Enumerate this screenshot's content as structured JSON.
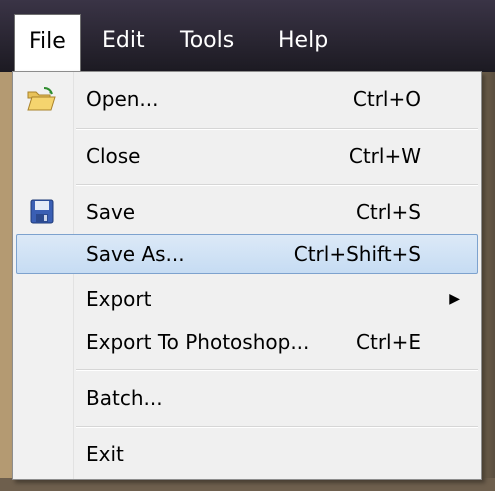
{
  "menubar": {
    "items": [
      {
        "label": "File"
      },
      {
        "label": "Edit"
      },
      {
        "label": "Tools"
      },
      {
        "label": "Help"
      }
    ]
  },
  "file_menu": {
    "items": [
      {
        "label": "Open...",
        "shortcut": "Ctrl+O",
        "icon": "open-folder-icon"
      },
      {
        "label": "Close",
        "shortcut": "Ctrl+W"
      },
      {
        "label": "Save",
        "shortcut": "Ctrl+S",
        "icon": "save-disk-icon"
      },
      {
        "label": "Save As...",
        "shortcut": "Ctrl+Shift+S",
        "highlighted": true
      },
      {
        "label": "Export",
        "submenu": true
      },
      {
        "label": "Export To Photoshop...",
        "shortcut": "Ctrl+E"
      },
      {
        "label": "Batch..."
      },
      {
        "label": "Exit"
      }
    ]
  },
  "colors": {
    "highlight": "#c6dcf3",
    "highlight_border": "#7da2ce",
    "menubar": "#1c1a22"
  }
}
